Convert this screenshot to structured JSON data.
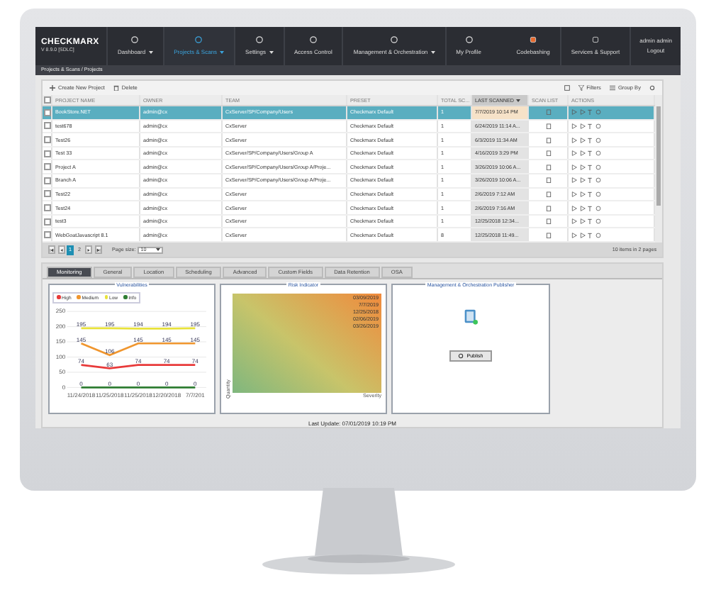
{
  "header": {
    "logo": "CHECKMARX",
    "version": "V 8.9.0 [SDLC]",
    "nav": [
      {
        "label": "Dashboard",
        "dropdown": true,
        "selected": false
      },
      {
        "label": "Projects & Scans",
        "dropdown": true,
        "selected": true
      },
      {
        "label": "Settings",
        "dropdown": true,
        "selected": false
      },
      {
        "label": "Access Control",
        "dropdown": false,
        "selected": false
      },
      {
        "label": "Management & Orchestration",
        "dropdown": true,
        "selected": false
      },
      {
        "label": "My Profile",
        "dropdown": false,
        "selected": false
      }
    ],
    "right": [
      "Codebashing",
      "Services & Support"
    ],
    "user": "admin admin",
    "logout": "Logout"
  },
  "breadcrumb": "Projects & Scans / Projects",
  "toolbar": {
    "create": "Create New Project",
    "delete": "Delete",
    "filters": "Filters",
    "group_by": "Group By"
  },
  "table": {
    "select_all_checked": false,
    "columns": [
      "PROJECT NAME",
      "OWNER",
      "TEAM",
      "PRESET",
      "TOTAL SC...",
      "LAST SCANNED",
      "SCAN LIST",
      "ACTIONS"
    ],
    "rows": [
      {
        "name": "BookStore.NET",
        "owner": "admin@cx",
        "team": "CxServer/SP/Company/Users",
        "preset": "Checkmarx Default",
        "total": "1",
        "last": "7/7/2019 10:14 PM",
        "selected": true
      },
      {
        "name": "test678",
        "owner": "admin@cx",
        "team": "CxServer",
        "preset": "Checkmarx Default",
        "total": "1",
        "last": "6/24/2019 11:14 A...",
        "selected": false
      },
      {
        "name": "Test26",
        "owner": "admin@cx",
        "team": "CxServer",
        "preset": "Checkmarx Default",
        "total": "1",
        "last": "6/3/2019 11:34 AM",
        "selected": false
      },
      {
        "name": "Test 33",
        "owner": "admin@cx",
        "team": "CxServer/SP/Company/Users/Group A",
        "preset": "Checkmarx Default",
        "total": "1",
        "last": "4/16/2019 3:29 PM",
        "selected": false
      },
      {
        "name": "Project A",
        "owner": "admin@cx",
        "team": "CxServer/SP/Company/Users/Group A/Proje...",
        "preset": "Checkmarx Default",
        "total": "1",
        "last": "3/26/2019 10:06 A...",
        "selected": false
      },
      {
        "name": "Branch A",
        "owner": "admin@cx",
        "team": "CxServer/SP/Company/Users/Group A/Proje...",
        "preset": "Checkmarx Default",
        "total": "1",
        "last": "3/26/2019 10:06 A...",
        "selected": false
      },
      {
        "name": "Test22",
        "owner": "admin@cx",
        "team": "CxServer",
        "preset": "Checkmarx Default",
        "total": "1",
        "last": "2/6/2019 7:12 AM",
        "selected": false
      },
      {
        "name": "Test24",
        "owner": "admin@cx",
        "team": "CxServer",
        "preset": "Checkmarx Default",
        "total": "1",
        "last": "2/6/2019 7:16 AM",
        "selected": false
      },
      {
        "name": "test3",
        "owner": "admin@cx",
        "team": "CxServer",
        "preset": "Checkmarx Default",
        "total": "1",
        "last": "12/25/2018 12:34...",
        "selected": false
      },
      {
        "name": "WebGoatJavascript 8.1",
        "owner": "admin@cx",
        "team": "CxServer",
        "preset": "Checkmarx Default",
        "total": "8",
        "last": "12/25/2018 11:49...",
        "selected": false
      }
    ]
  },
  "pager": {
    "pages": [
      {
        "label": "1",
        "selected": true
      },
      {
        "label": "2",
        "selected": false
      }
    ],
    "page_size_label": "Page size:",
    "page_size": "10",
    "summary": "10 items in 2 pages"
  },
  "tabs": [
    {
      "label": "Monitoring",
      "selected": true
    },
    {
      "label": "General",
      "selected": false
    },
    {
      "label": "Location",
      "selected": false
    },
    {
      "label": "Scheduling",
      "selected": false
    },
    {
      "label": "Advanced",
      "selected": false
    },
    {
      "label": "Custom Fields",
      "selected": false
    },
    {
      "label": "Data Retention",
      "selected": false
    },
    {
      "label": "OSA",
      "selected": false
    }
  ],
  "vulnerabilities": {
    "title": "Vulnerabilities",
    "chart_data": {
      "type": "line",
      "categories": [
        "11/24/2018",
        "11/25/2018",
        "11/25/2018",
        "12/20/2018",
        "7/7/201"
      ],
      "yticks": [
        0,
        50,
        100,
        150,
        200,
        250
      ],
      "ylim": [
        0,
        250
      ],
      "data_labels": true,
      "grid": true,
      "legend": "top",
      "series": [
        {
          "name": "High",
          "color": "#e83a3a",
          "values": [
            74,
            63,
            74,
            74,
            74
          ]
        },
        {
          "name": "Medium",
          "color": "#f0962e",
          "values": [
            145,
            106,
            145,
            145,
            145
          ]
        },
        {
          "name": "Low",
          "color": "#e8e23a",
          "values": [
            195,
            195,
            194,
            194,
            195
          ]
        },
        {
          "name": "Info",
          "color": "#2e7d32",
          "values": [
            0,
            0,
            0,
            0,
            0
          ]
        }
      ]
    }
  },
  "risk": {
    "title": "Risk Indicator",
    "dates": [
      "03/09/2019",
      "7/7/2019",
      "12/25/2018",
      "02/06/2019",
      "03/26/2019"
    ],
    "ylabel": "Quantity",
    "xlabel": "Severity"
  },
  "publisher": {
    "title": "Management & Orchestration Publisher",
    "button": "Publish"
  },
  "last_update": "Last Update: 07/01/2019 10:19 PM"
}
